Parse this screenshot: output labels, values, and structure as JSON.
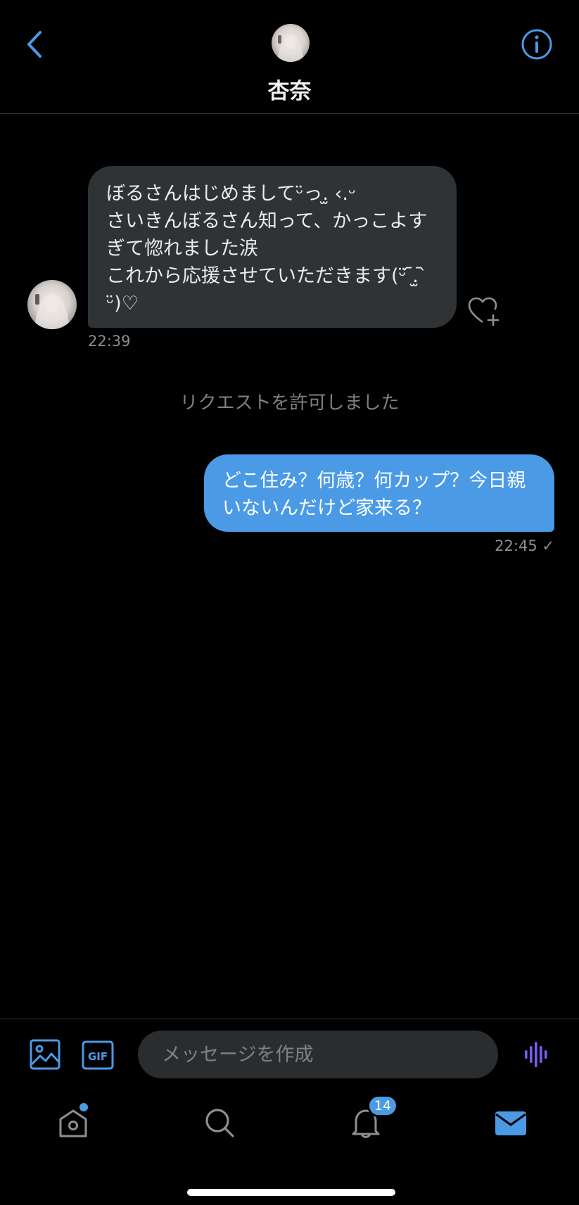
{
  "header": {
    "contact_name": "杏奈",
    "back_icon": "chevron-left-icon",
    "info_icon": "info-icon"
  },
  "messages": {
    "incoming": {
      "text": "ぼるさんはじめましてᵕ̈っ.̫ ‹.ᵕ\nさいきんぼるさん知って、かっこよすぎて惚れました涙\nこれから応援させていただきます(ᵕ̈ ᷇.̫ ᷆ ᵕ̈)♡",
      "time": "22:39"
    },
    "system": "リクエストを許可しました",
    "outgoing": {
      "text": "どこ住み？何歳？何カップ？今日親いないんだけど家来る？",
      "time": "22:45",
      "status_mark": "✓"
    }
  },
  "composer": {
    "placeholder": "メッセージを作成",
    "gif_label": "GIF"
  },
  "tabbar": {
    "notification_count": "14"
  },
  "colors": {
    "accent": "#4a9ae6",
    "incoming_bubble": "#2f3336",
    "background": "#000000",
    "voice": "#7b5cf0"
  }
}
